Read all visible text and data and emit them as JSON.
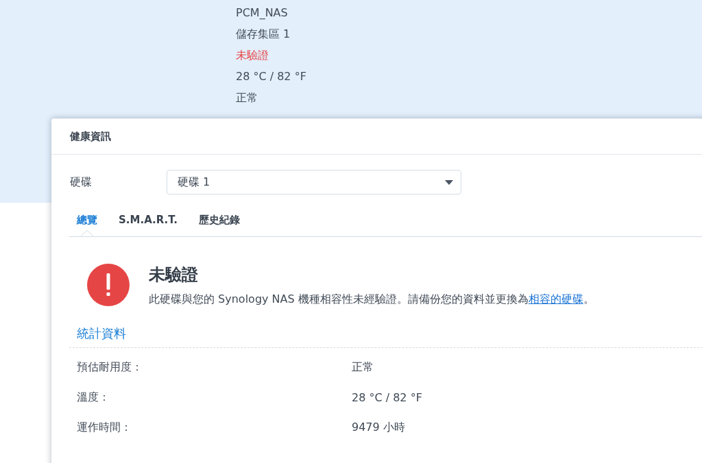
{
  "info_panel": {
    "details": [
      {
        "text": "PCM_NAS",
        "kind": "normal"
      },
      {
        "text": "儲存集區 1",
        "kind": "normal"
      },
      {
        "text": "未驗證",
        "kind": "warning"
      },
      {
        "text": "28 °C / 82 °F",
        "kind": "normal"
      },
      {
        "text": "正常",
        "kind": "normal"
      }
    ]
  },
  "dialog": {
    "title": "健康資訊",
    "drive_field": {
      "label": "硬碟",
      "value": "硬碟 1"
    },
    "tabs": [
      {
        "label": "總覽",
        "selected": true
      },
      {
        "label": "S.M.A.R.T.",
        "selected": false
      },
      {
        "label": "歷史紀錄",
        "selected": false
      }
    ],
    "alert": {
      "kind": "error",
      "title": "未驗證",
      "message": "此硬碟與您的 Synology NAS 機種相容性未經驗證。請備份您的資料並更換為",
      "link": "相容的硬碟",
      "message_end": "。"
    },
    "statistics": {
      "title": "統計資料",
      "rows": [
        {
          "label": "預估耐用度：",
          "value": "正常"
        },
        {
          "label": "溫度：",
          "value": "28 °C / 82 °F"
        },
        {
          "label": "運作時間：",
          "value": "9479 小時"
        }
      ]
    }
  }
}
